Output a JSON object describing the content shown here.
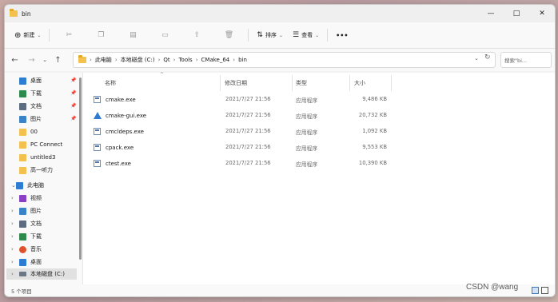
{
  "window": {
    "tab_title": "bin",
    "controls": {
      "minimize": "—",
      "maximize": "□",
      "close": "✕"
    }
  },
  "toolbar": {
    "new_label": "新建",
    "sort_label": "排序",
    "view_label": "查看",
    "more_label": "•••",
    "icons": [
      "cut-icon",
      "copy-icon",
      "paste-icon",
      "rename-icon",
      "share-icon",
      "delete-icon"
    ]
  },
  "address": {
    "crumbs": [
      "此电脑",
      "本地磁盘 (C:)",
      "Qt",
      "Tools",
      "CMake_64",
      "bin"
    ],
    "separator": "›",
    "search_placeholder": "搜索\"bi..."
  },
  "sidebar": {
    "quick": [
      {
        "label": "桌面",
        "icon": "desktop-icon",
        "color": "#2d7dd2"
      },
      {
        "label": "下载",
        "icon": "download-icon",
        "color": "#2f8a4e"
      },
      {
        "label": "文档",
        "icon": "document-icon",
        "color": "#5b6b82"
      },
      {
        "label": "图片",
        "icon": "picture-icon",
        "color": "#3b83c9"
      },
      {
        "label": "00",
        "icon": "folder-icon",
        "color": "#f2c14e"
      },
      {
        "label": "PC Connect",
        "icon": "folder-icon",
        "color": "#f2c14e"
      },
      {
        "label": "untitled3",
        "icon": "folder-icon",
        "color": "#f2c14e"
      },
      {
        "label": "高一听力",
        "icon": "folder-icon",
        "color": "#f2c14e"
      }
    ],
    "this_pc": {
      "label": "此电脑",
      "icon": "computer-icon",
      "color": "#2d7dd2"
    },
    "pc_items": [
      {
        "label": "视频",
        "icon": "video-icon",
        "color": "#8a3fc4"
      },
      {
        "label": "图片",
        "icon": "picture-icon",
        "color": "#3b83c9"
      },
      {
        "label": "文档",
        "icon": "document-icon",
        "color": "#5b6b82"
      },
      {
        "label": "下载",
        "icon": "download-icon",
        "color": "#2f8a4e"
      },
      {
        "label": "音乐",
        "icon": "music-icon",
        "color": "#e0522b"
      },
      {
        "label": "桌面",
        "icon": "desktop-icon",
        "color": "#2d7dd2"
      },
      {
        "label": "本地磁盘 (C:)",
        "icon": "drive-icon",
        "color": "#6b7785"
      }
    ]
  },
  "files": {
    "headers": {
      "name": "名称",
      "date": "修改日期",
      "type": "类型",
      "size": "大小"
    },
    "rows": [
      {
        "name": "cmake.exe",
        "date": "2021/7/27 21:56",
        "type": "应用程序",
        "size": "9,486 KB",
        "icon": "exe-icon"
      },
      {
        "name": "cmake-gui.exe",
        "date": "2021/7/27 21:56",
        "type": "应用程序",
        "size": "20,732 KB",
        "icon": "cmake-gui-icon"
      },
      {
        "name": "cmcldeps.exe",
        "date": "2021/7/27 21:56",
        "type": "应用程序",
        "size": "1,092 KB",
        "icon": "exe-icon"
      },
      {
        "name": "cpack.exe",
        "date": "2021/7/27 21:56",
        "type": "应用程序",
        "size": "9,553 KB",
        "icon": "exe-icon"
      },
      {
        "name": "ctest.exe",
        "date": "2021/7/27 21:56",
        "type": "应用程序",
        "size": "10,390 KB",
        "icon": "exe-icon"
      }
    ]
  },
  "status": {
    "count": "5 个项目"
  },
  "watermark": "CSDN @wang"
}
